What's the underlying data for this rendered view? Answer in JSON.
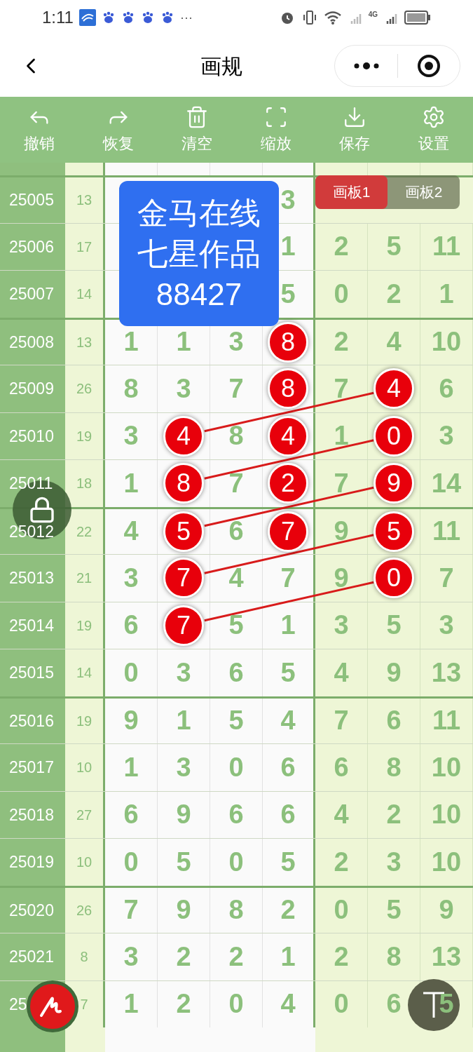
{
  "status_bar": {
    "time": "1:11",
    "more": "···",
    "network": "4G"
  },
  "header": {
    "title": "画规"
  },
  "toolbar": [
    {
      "kind": "undo",
      "label": "撤销"
    },
    {
      "kind": "redo",
      "label": "恢复"
    },
    {
      "kind": "clear",
      "label": "清空"
    },
    {
      "kind": "zoom",
      "label": "缩放"
    },
    {
      "kind": "save",
      "label": "保存"
    },
    {
      "kind": "settings",
      "label": "设置"
    }
  ],
  "note": {
    "lines": [
      "金马在线",
      "七星作品",
      "88427"
    ]
  },
  "boards": [
    {
      "label": "画板1",
      "selected": true
    },
    {
      "label": "画板2",
      "selected": false
    }
  ],
  "groups": [
    {
      "rows": [
        {
          "issue": "25005",
          "sum": "13",
          "cells": [
            null,
            null,
            null,
            {
              "kind": "plain",
              "value": "3"
            },
            null,
            null,
            null
          ]
        },
        {
          "issue": "25006",
          "sum": "17",
          "cells": [
            null,
            null,
            null,
            {
              "kind": "plain",
              "value": "1"
            },
            {
              "kind": "plain",
              "value": "2"
            },
            {
              "kind": "plain",
              "value": "5"
            },
            {
              "kind": "plain",
              "value": "11"
            }
          ]
        },
        {
          "issue": "25007",
          "sum": "14",
          "cells": [
            null,
            null,
            null,
            {
              "kind": "plain",
              "value": "5"
            },
            {
              "kind": "plain",
              "value": "0"
            },
            {
              "kind": "plain",
              "value": "2"
            },
            {
              "kind": "plain",
              "value": "1"
            }
          ]
        }
      ]
    },
    {
      "rows": [
        {
          "issue": "25008",
          "sum": "13",
          "cells": [
            {
              "kind": "plain",
              "value": "1"
            },
            {
              "kind": "plain",
              "value": "1"
            },
            {
              "kind": "plain",
              "value": "3"
            },
            {
              "kind": "circled",
              "value": "8"
            },
            {
              "kind": "plain",
              "value": "2"
            },
            {
              "kind": "plain",
              "value": "4"
            },
            {
              "kind": "plain",
              "value": "10"
            }
          ]
        },
        {
          "issue": "25009",
          "sum": "26",
          "cells": [
            {
              "kind": "plain",
              "value": "8"
            },
            {
              "kind": "plain",
              "value": "3"
            },
            {
              "kind": "plain",
              "value": "7"
            },
            {
              "kind": "circled",
              "value": "8",
              "linked": false
            },
            {
              "kind": "plain",
              "value": "7"
            },
            {
              "kind": "circled",
              "value": "4"
            },
            {
              "kind": "plain",
              "value": "6"
            }
          ]
        },
        {
          "issue": "25010",
          "sum": "19",
          "cells": [
            {
              "kind": "plain",
              "value": "3"
            },
            {
              "kind": "circled",
              "value": "4",
              "linked": true
            },
            {
              "kind": "plain",
              "value": "8"
            },
            {
              "kind": "circled",
              "value": "4",
              "linked": false
            },
            {
              "kind": "plain",
              "value": "1"
            },
            {
              "kind": "circled",
              "value": "0"
            },
            {
              "kind": "plain",
              "value": "3"
            }
          ]
        },
        {
          "issue": "25011",
          "sum": "18",
          "cells": [
            {
              "kind": "plain",
              "value": "1"
            },
            {
              "kind": "circled",
              "value": "8",
              "linked": true
            },
            {
              "kind": "plain",
              "value": "7"
            },
            {
              "kind": "circled",
              "value": "2",
              "linked": false
            },
            {
              "kind": "plain",
              "value": "7"
            },
            {
              "kind": "circled",
              "value": "9"
            },
            {
              "kind": "plain",
              "value": "14"
            }
          ]
        }
      ]
    },
    {
      "rows": [
        {
          "issue": "25012",
          "sum": "22",
          "cells": [
            {
              "kind": "plain",
              "value": "4"
            },
            {
              "kind": "circled",
              "value": "5",
              "linked": true
            },
            {
              "kind": "plain",
              "value": "6"
            },
            {
              "kind": "circled",
              "value": "7",
              "linked": false
            },
            {
              "kind": "plain",
              "value": "9"
            },
            {
              "kind": "circled",
              "value": "5"
            },
            {
              "kind": "plain",
              "value": "11"
            }
          ]
        },
        {
          "issue": "25013",
          "sum": "21",
          "cells": [
            {
              "kind": "plain",
              "value": "3"
            },
            {
              "kind": "circled",
              "value": "7",
              "linked": true
            },
            {
              "kind": "plain",
              "value": "4"
            },
            {
              "kind": "plain",
              "value": "7"
            },
            {
              "kind": "plain",
              "value": "9"
            },
            {
              "kind": "circled",
              "value": "0"
            },
            {
              "kind": "plain",
              "value": "7"
            }
          ]
        },
        {
          "issue": "25014",
          "sum": "19",
          "cells": [
            {
              "kind": "plain",
              "value": "6"
            },
            {
              "kind": "circled",
              "value": "7",
              "linked": true
            },
            {
              "kind": "plain",
              "value": "5"
            },
            {
              "kind": "plain",
              "value": "1"
            },
            {
              "kind": "plain",
              "value": "3"
            },
            {
              "kind": "plain",
              "value": "5"
            },
            {
              "kind": "plain",
              "value": "3"
            }
          ]
        },
        {
          "issue": "25015",
          "sum": "14",
          "cells": [
            {
              "kind": "plain",
              "value": "0"
            },
            {
              "kind": "plain",
              "value": "3"
            },
            {
              "kind": "plain",
              "value": "6"
            },
            {
              "kind": "plain",
              "value": "5"
            },
            {
              "kind": "plain",
              "value": "4"
            },
            {
              "kind": "plain",
              "value": "9"
            },
            {
              "kind": "plain",
              "value": "13"
            }
          ]
        }
      ]
    },
    {
      "rows": [
        {
          "issue": "25016",
          "sum": "19",
          "cells": [
            {
              "kind": "plain",
              "value": "9"
            },
            {
              "kind": "plain",
              "value": "1"
            },
            {
              "kind": "plain",
              "value": "5"
            },
            {
              "kind": "plain",
              "value": "4"
            },
            {
              "kind": "plain",
              "value": "7"
            },
            {
              "kind": "plain",
              "value": "6"
            },
            {
              "kind": "plain",
              "value": "11"
            }
          ]
        },
        {
          "issue": "25017",
          "sum": "10",
          "cells": [
            {
              "kind": "plain",
              "value": "1"
            },
            {
              "kind": "plain",
              "value": "3"
            },
            {
              "kind": "plain",
              "value": "0"
            },
            {
              "kind": "plain",
              "value": "6"
            },
            {
              "kind": "plain",
              "value": "6"
            },
            {
              "kind": "plain",
              "value": "8"
            },
            {
              "kind": "plain",
              "value": "10"
            }
          ]
        },
        {
          "issue": "25018",
          "sum": "27",
          "cells": [
            {
              "kind": "plain",
              "value": "6"
            },
            {
              "kind": "plain",
              "value": "9"
            },
            {
              "kind": "plain",
              "value": "6"
            },
            {
              "kind": "plain",
              "value": "6"
            },
            {
              "kind": "plain",
              "value": "4"
            },
            {
              "kind": "plain",
              "value": "2"
            },
            {
              "kind": "plain",
              "value": "10"
            }
          ]
        },
        {
          "issue": "25019",
          "sum": "10",
          "cells": [
            {
              "kind": "plain",
              "value": "0"
            },
            {
              "kind": "plain",
              "value": "5"
            },
            {
              "kind": "plain",
              "value": "0"
            },
            {
              "kind": "plain",
              "value": "5"
            },
            {
              "kind": "plain",
              "value": "2"
            },
            {
              "kind": "plain",
              "value": "3"
            },
            {
              "kind": "plain",
              "value": "10"
            }
          ]
        }
      ]
    },
    {
      "rows": [
        {
          "issue": "25020",
          "sum": "26",
          "cells": [
            {
              "kind": "plain",
              "value": "7"
            },
            {
              "kind": "plain",
              "value": "9"
            },
            {
              "kind": "plain",
              "value": "8"
            },
            {
              "kind": "plain",
              "value": "2"
            },
            {
              "kind": "plain",
              "value": "0"
            },
            {
              "kind": "plain",
              "value": "5"
            },
            {
              "kind": "plain",
              "value": "9"
            }
          ]
        },
        {
          "issue": "25021",
          "sum": "8",
          "cells": [
            {
              "kind": "plain",
              "value": "3"
            },
            {
              "kind": "plain",
              "value": "2"
            },
            {
              "kind": "plain",
              "value": "2"
            },
            {
              "kind": "plain",
              "value": "1"
            },
            {
              "kind": "plain",
              "value": "2"
            },
            {
              "kind": "plain",
              "value": "8"
            },
            {
              "kind": "plain",
              "value": "13"
            }
          ]
        },
        {
          "issue": "25",
          "sum": "7",
          "cells": [
            {
              "kind": "plain",
              "value": "1"
            },
            {
              "kind": "plain",
              "value": "2"
            },
            {
              "kind": "plain",
              "value": "0"
            },
            {
              "kind": "plain",
              "value": "4"
            },
            {
              "kind": "plain",
              "value": "0"
            },
            {
              "kind": "plain",
              "value": "6"
            },
            {
              "kind": "plain",
              "value": "5"
            }
          ]
        }
      ]
    }
  ]
}
